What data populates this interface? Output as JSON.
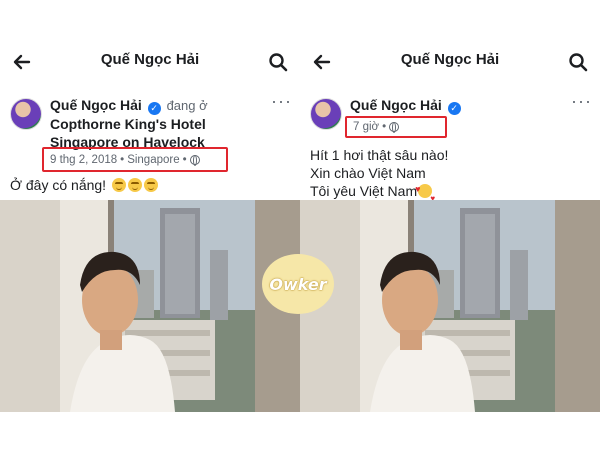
{
  "left": {
    "topbar": {
      "title": "Quế Ngọc Hải"
    },
    "post": {
      "author": "Quế Ngọc Hải",
      "checkin_prefix": "đang ở",
      "place": "Copthorne King's Hotel Singapore on Havelock",
      "date": "9 thg 2, 2018",
      "location": "Singapore",
      "caption": "Ở đây có nắng!"
    }
  },
  "right": {
    "topbar": {
      "title": "Quế Ngọc Hải"
    },
    "post": {
      "author": "Quế Ngọc Hải",
      "time": "7 giờ",
      "caption_lines": [
        "Hít 1 hơi thật sâu nào!",
        "Xin chào Việt Nam",
        "Tôi yêu Việt Nam"
      ]
    }
  },
  "separator": "•",
  "watermark": "Owker",
  "colors": {
    "highlight": "#e0262e",
    "verified": "#1877f2",
    "watermark_bg": "#f6e7a8"
  },
  "icons": [
    "back-arrow-icon",
    "search-icon",
    "more-icon",
    "verified-icon",
    "globe-icon",
    "sunglasses-emoji-icon",
    "smiling-hearts-emoji-icon"
  ]
}
